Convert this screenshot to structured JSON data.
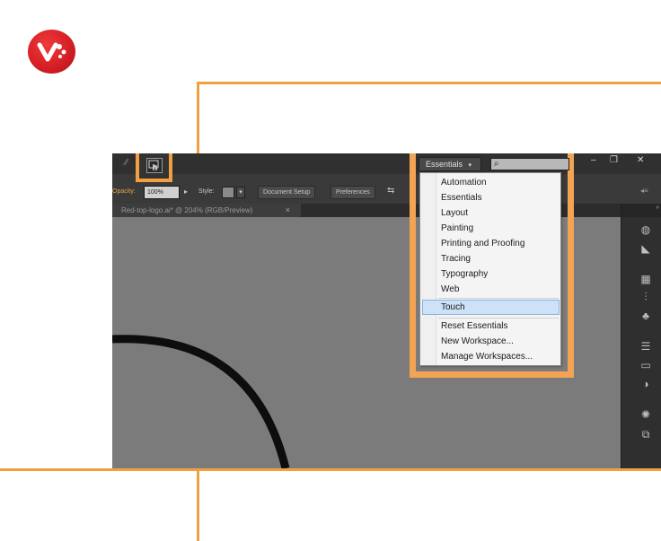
{
  "app": {
    "document_tab": "Red-top-logo.ai* @ 204% (RGB/Preview)",
    "tab_close": "×",
    "opacity_label": "Opacity:",
    "opacity_value": "100%",
    "style_label": "Style:",
    "document_setup": "Document Setup",
    "preferences": "Preferences"
  },
  "workspace": {
    "current": "Essentials",
    "caret": "▾",
    "menu_items": [
      "Automation",
      "Essentials",
      "Layout",
      "Painting",
      "Printing and Proofing",
      "Tracing",
      "Typography",
      "Web"
    ],
    "selected_item": "Touch",
    "actions": [
      "Reset Essentials",
      "New Workspace...",
      "Manage Workspaces..."
    ]
  },
  "window_controls": {
    "minimize": "–",
    "restore": "❐",
    "close": "✕"
  },
  "colors": {
    "accent": "#f0a040",
    "logo_red": "#d71f26",
    "menu_highlight": "#cde2f7"
  }
}
